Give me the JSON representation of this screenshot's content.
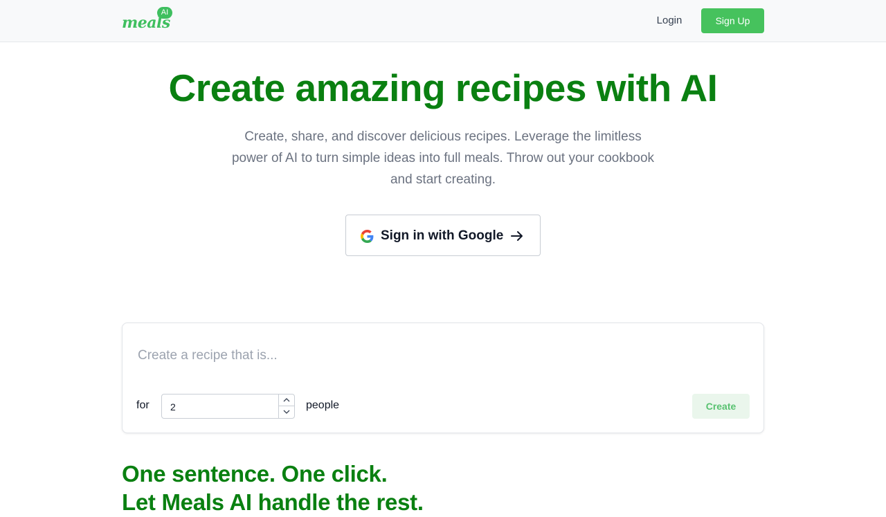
{
  "colors": {
    "brand_green": "#46c25d",
    "heading_green": "#0a8011",
    "muted_text": "#6b7280",
    "navbar_bg": "#f8f9fa"
  },
  "navbar": {
    "logo_text": "meals",
    "logo_badge": "AI",
    "login_label": "Login",
    "signup_label": "Sign Up"
  },
  "hero": {
    "title": "Create amazing recipes with AI",
    "subtitle": "Create, share, and discover delicious recipes. Leverage the limitless power of AI to turn simple ideas into full meals. Throw out your cookbook and start creating.",
    "google_button": {
      "label": "Sign in with Google",
      "icon": "google-icon",
      "trailing_icon": "arrow-right-icon"
    }
  },
  "recipe_form": {
    "prompt_placeholder": "Create a recipe that is...",
    "prompt_value": "",
    "for_label": "for",
    "servings_value": "2",
    "people_label": "people",
    "create_label": "Create",
    "stepper_icons": [
      "chevron-up-icon",
      "chevron-down-icon"
    ]
  },
  "section": {
    "title_line1": "One sentence. One click.",
    "title_line2": "Let Meals AI handle the rest."
  }
}
